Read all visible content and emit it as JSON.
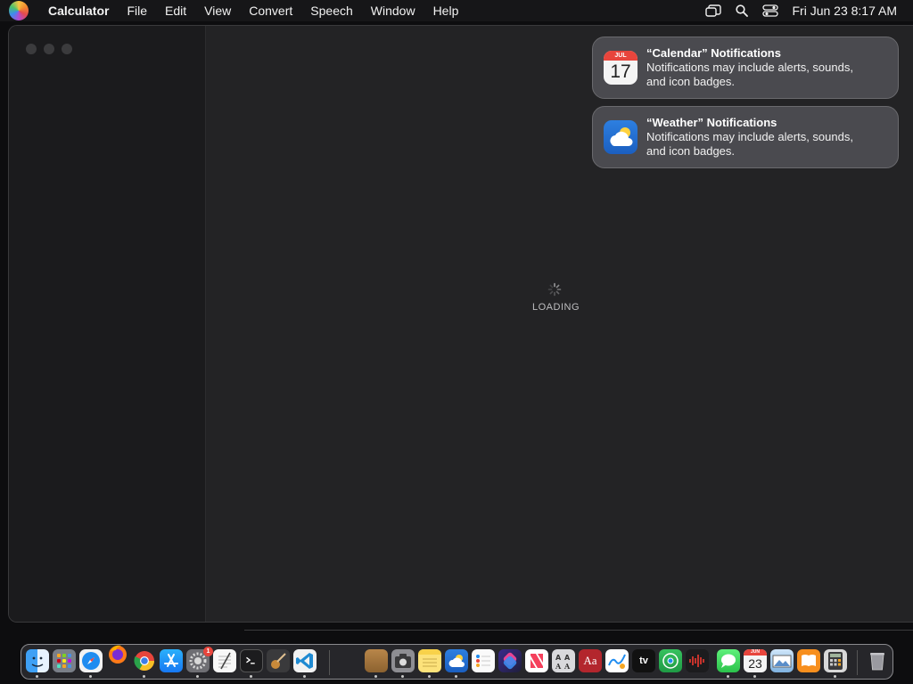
{
  "menubar": {
    "app_name": "Calculator",
    "items": [
      "File",
      "Edit",
      "View",
      "Convert",
      "Speech",
      "Window",
      "Help"
    ],
    "clock": "Fri Jun 23  8:17 AM"
  },
  "main": {
    "loading_label": "LOADING"
  },
  "notifications": [
    {
      "title": "“Calendar” Notifications",
      "body_line1": "Notifications may include alerts, sounds,",
      "body_line2": "and icon badges.",
      "icon_month": "JUL",
      "icon_day": "17"
    },
    {
      "title": "“Weather” Notifications",
      "body_line1": "Notifications may include alerts, sounds,",
      "body_line2": "and icon badges."
    }
  ],
  "dock": {
    "settings_badge": "1",
    "calendar_month": "JUN",
    "calendar_day": "23",
    "tv_label": "tv",
    "dictionary_label": "Aa"
  },
  "colors": {
    "accent_red": "#e8453c",
    "window_bg": "#232325",
    "notification_bg": "#4e4e52"
  }
}
